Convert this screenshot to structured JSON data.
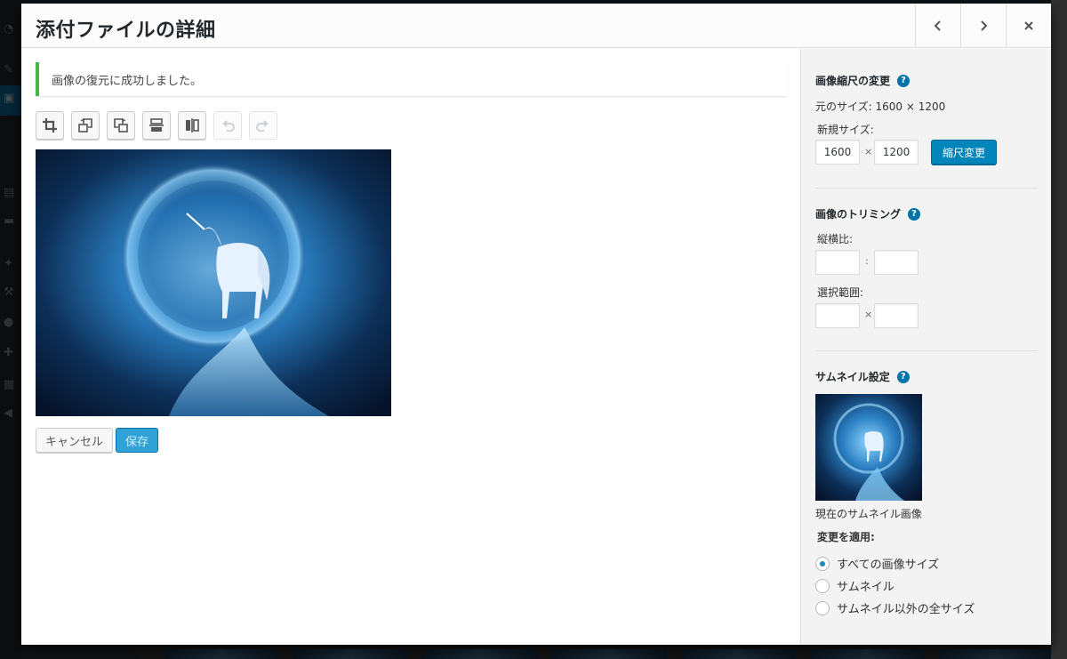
{
  "modal": {
    "title": "添付ファイルの詳細",
    "notice": "画像の復元に成功しました。"
  },
  "toolbar": {
    "buttons": [
      {
        "name": "crop-button",
        "icon": "crop-icon",
        "enabled": true
      },
      {
        "name": "rotate-left-button",
        "icon": "rotate-left-icon",
        "enabled": true
      },
      {
        "name": "rotate-right-button",
        "icon": "rotate-right-icon",
        "enabled": true
      },
      {
        "name": "flip-vertical-button",
        "icon": "flip-vertical-icon",
        "enabled": true
      },
      {
        "name": "flip-horizontal-button",
        "icon": "flip-horizontal-icon",
        "enabled": true
      },
      {
        "name": "undo-button",
        "icon": "undo-icon",
        "enabled": false
      },
      {
        "name": "redo-button",
        "icon": "redo-icon",
        "enabled": false
      }
    ]
  },
  "actions": {
    "cancel": "キャンセル",
    "save": "保存"
  },
  "scale": {
    "title": "画像縮尺の変更",
    "original_size_label": "元のサイズ: ",
    "original_size_value": "1600 × 1200",
    "new_size_label": "新規サイズ:",
    "width": "1600",
    "height": "1200",
    "times": "×",
    "button": "縮尺変更"
  },
  "crop": {
    "title": "画像のトリミング",
    "aspect_ratio_label": "縦横比:",
    "aspect_sep": ":",
    "selection_label": "選択範囲:",
    "selection_sep": "×"
  },
  "thumbnail": {
    "title": "サムネイル設定",
    "current_label": "現在のサムネイル画像",
    "apply_label": "変更を適用:",
    "options": [
      {
        "label": "すべての画像サイズ",
        "checked": true
      },
      {
        "label": "サムネイル",
        "checked": false
      },
      {
        "label": "サムネイル以外の全サイズ",
        "checked": false
      }
    ]
  },
  "help_mark": "?",
  "colors": {
    "accent": "#0085ba",
    "success": "#46b450",
    "help": "#0073aa"
  }
}
